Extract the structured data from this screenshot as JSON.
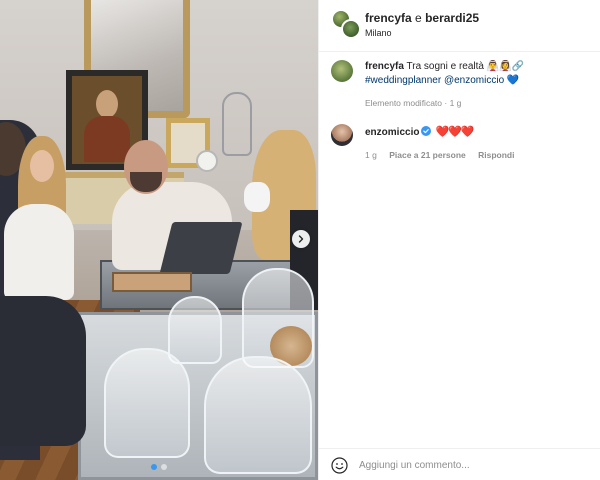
{
  "post": {
    "carousel": {
      "slide_count": 2,
      "active_slide": 1
    }
  },
  "header": {
    "user1": "frencyfa",
    "separator": "e",
    "user2": "berardi25",
    "location": "Milano"
  },
  "caption": {
    "username": "frencyfa",
    "text": "Tra sogni e realtà 👰‍♂️👰‍♀️🔗",
    "hashtag": "#weddingplanner",
    "mention": "@enzomiccio",
    "heart": "💙",
    "meta": "Elemento modificato · 1 g"
  },
  "comment": {
    "username": "enzomiccio",
    "verified": true,
    "hearts": "❤️❤️❤️",
    "time": "1 g",
    "likes": "Piace a 21 persone",
    "reply": "Rispondi"
  },
  "footer": {
    "placeholder": "Aggiungi un commento..."
  },
  "colors": {
    "link": "#00376b",
    "meta": "#8e8e8e",
    "verified": "#3897f0",
    "active_dot": "#3897f0"
  },
  "icons": {
    "carousel_next": "chevron-right-icon",
    "verified": "verified-badge-icon",
    "emoji": "smiley-icon"
  }
}
